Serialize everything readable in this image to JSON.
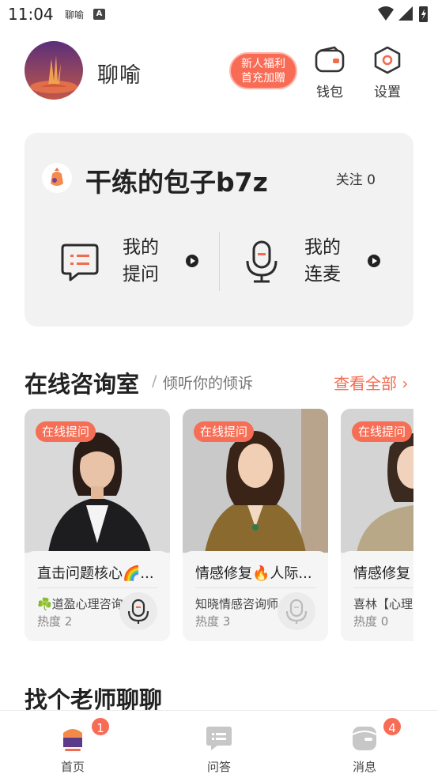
{
  "status_bar": {
    "time": "11:04",
    "app_label": "聊喻",
    "notification_icon": "A"
  },
  "header": {
    "logo_text": "聊喻",
    "promo_line1": "新人福利",
    "promo_line2": "首充加赠",
    "wallet_label": "钱包",
    "settings_label": "设置"
  },
  "profile": {
    "username": "干练的包子b7z",
    "follow_text": "关注 0",
    "ask_line1": "我的",
    "ask_line2": "提问",
    "mic_line1": "我的",
    "mic_line2": "连麦"
  },
  "consult": {
    "title": "在线咨询室",
    "slash": "/",
    "subtitle": "倾听你的倾诉",
    "see_all": "查看全部 ›",
    "cards": [
      {
        "tag": "在线提问",
        "title": "直击问题核心🌈...",
        "name": "☘️道盈心理咨询",
        "heat": "热度 2"
      },
      {
        "tag": "在线提问",
        "title": "情感修复🔥人际...",
        "name": "知晓情感咨询师",
        "heat": "热度 3"
      },
      {
        "tag": "在线提问",
        "title": "情感修复",
        "name": "喜林【心理",
        "heat": "热度 0"
      }
    ]
  },
  "teachers": {
    "title": "找个老师聊聊"
  },
  "bottom_nav": {
    "home_label": "首页",
    "qa_label": "问答",
    "msg_label": "消息",
    "home_badge": "1",
    "msg_badge": "4"
  },
  "colors": {
    "accent": "#f86b55",
    "card_bg": "#f2f2f2"
  }
}
